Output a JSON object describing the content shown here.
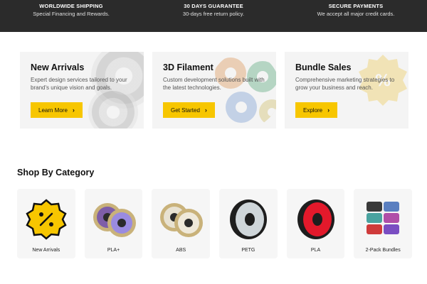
{
  "infobar": [
    {
      "title": "WORLDWIDE SHIPPING",
      "sub": "Special Financing and Rewards."
    },
    {
      "title": "30 DAYS GUARANTEE",
      "sub": "30-days free return policy."
    },
    {
      "title": "SECURE PAYMENTS",
      "sub": "We accept all major credit cards."
    }
  ],
  "promos": [
    {
      "title": "New Arrivals",
      "desc": "Expert design services tailored to your brand's unique vision and goals.",
      "button": "Learn More"
    },
    {
      "title": "3D Filament",
      "desc": "Custom development solutions built with the latest technologies.",
      "button": "Get Started"
    },
    {
      "title": "Bundle Sales",
      "desc": "Comprehensive marketing strategies to grow your business and reach.",
      "button": "Explore"
    }
  ],
  "section_title": "Shop By Category",
  "categories": [
    {
      "label": "New Arrivals",
      "icon": "percent-badge-icon"
    },
    {
      "label": "PLA+",
      "icon": "pla-plus-spools-image"
    },
    {
      "label": "ABS",
      "icon": "abs-spools-image"
    },
    {
      "label": "PETG",
      "icon": "petg-spool-image"
    },
    {
      "label": "PLA",
      "icon": "pla-spool-image"
    },
    {
      "label": "2-Pack Bundles",
      "icon": "bundle-spools-image"
    }
  ],
  "colors": {
    "accent": "#f7c600",
    "infobar_bg": "#2b2b2b",
    "card_bg": "#f4f4f4"
  }
}
